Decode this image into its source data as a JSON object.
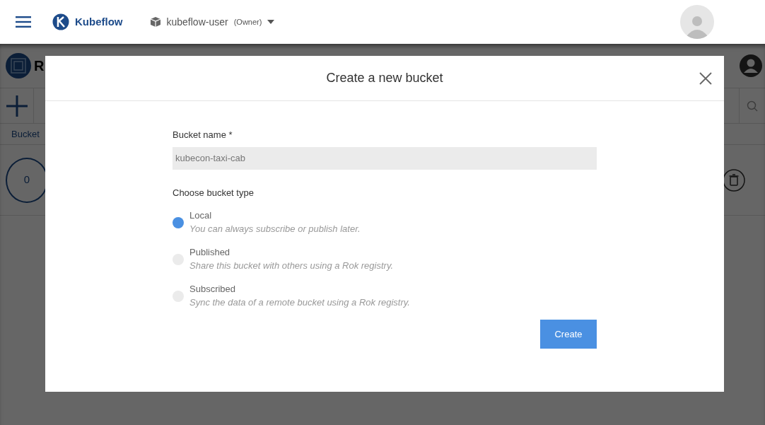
{
  "topbar": {
    "brand": "Kubeflow",
    "namespace": "kubeflow-user",
    "role": "(Owner)"
  },
  "background_page": {
    "title": "R",
    "column_header": "Bucket",
    "bucket_count": "0"
  },
  "dialog": {
    "title": "Create a new bucket",
    "name_label": "Bucket name *",
    "name_value": "kubecon-taxi-cab",
    "type_label": "Choose bucket type",
    "types": [
      {
        "label": "Local",
        "description": "You can always subscribe or publish later.",
        "selected": true
      },
      {
        "label": "Published",
        "description": "Share this bucket with others using a Rok registry.",
        "selected": false
      },
      {
        "label": "Subscribed",
        "description": "Sync the data of a remote bucket using a Rok registry.",
        "selected": false
      }
    ],
    "submit": "Create"
  }
}
